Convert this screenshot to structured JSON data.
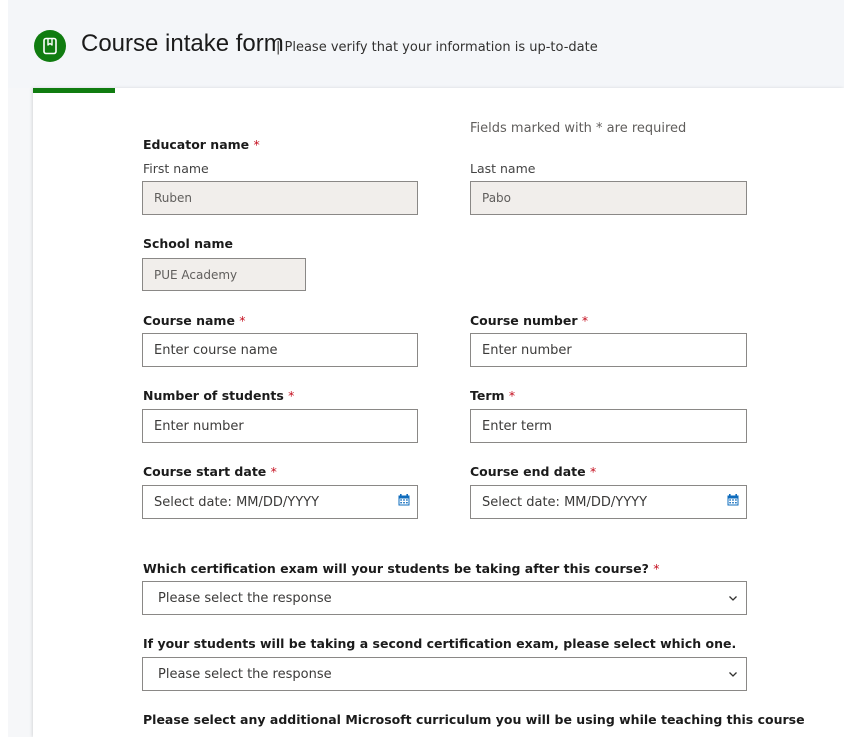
{
  "header": {
    "title": "Course intake form",
    "subtitle": "| Please verify that your information is up-to-date",
    "icon": "notebook-icon",
    "accent_color": "#107c10"
  },
  "form": {
    "required_note": "Fields marked with * are required",
    "required_mark": "*",
    "educator": {
      "label": "Educator name",
      "first_label": "First name",
      "first_value": "Ruben",
      "last_label": "Last name",
      "last_value": "Pabo"
    },
    "school": {
      "label": "School name",
      "value": "PUE Academy"
    },
    "course_name": {
      "label": "Course name",
      "placeholder": "Enter course name"
    },
    "course_number": {
      "label": "Course number",
      "placeholder": "Enter number"
    },
    "num_students": {
      "label": "Number of students",
      "placeholder": "Enter number"
    },
    "term": {
      "label": "Term",
      "placeholder": "Enter term"
    },
    "start_date": {
      "label": "Course start date",
      "placeholder": "Select date: MM/DD/YYYY",
      "icon": "calendar-icon"
    },
    "end_date": {
      "label": "Course end date",
      "placeholder": "Select date: MM/DD/YYYY",
      "icon": "calendar-icon"
    },
    "exam1": {
      "label": "Which certification exam will your students be taking after this course?",
      "value": "Please select the response",
      "icon": "chevron-down-icon"
    },
    "exam2": {
      "label": "If your students will be taking a second certification exam, please select which one.",
      "value": "Please select the response",
      "icon": "chevron-down-icon"
    },
    "curriculum": {
      "label": "Please select any additional Microsoft curriculum you will be using while teaching this course"
    }
  }
}
